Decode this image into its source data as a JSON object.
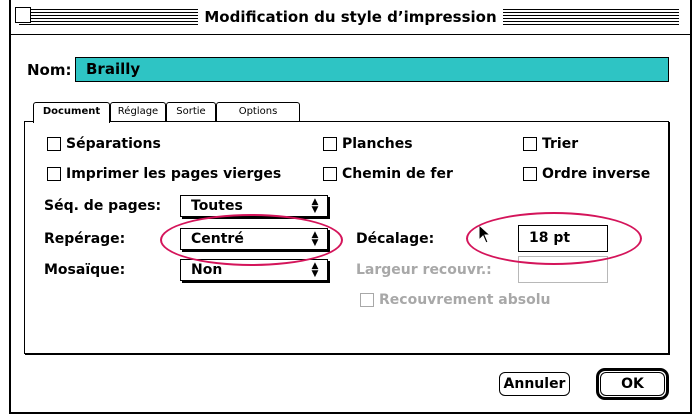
{
  "window": {
    "title": "Modification du style d’impression"
  },
  "name_row": {
    "label": "Nom:",
    "value": "Brailly"
  },
  "tabs": [
    {
      "label": "Document",
      "active": true
    },
    {
      "label": "Réglage",
      "active": false
    },
    {
      "label": "Sortie",
      "active": false
    },
    {
      "label": "Options",
      "active": false
    }
  ],
  "document_tab": {
    "checkboxes": {
      "separations": {
        "label": "Séparations",
        "checked": false,
        "enabled": true
      },
      "planches": {
        "label": "Planches",
        "checked": false,
        "enabled": true
      },
      "trier": {
        "label": "Trier",
        "checked": false,
        "enabled": true
      },
      "blank_pages": {
        "label": "Imprimer les pages vierges",
        "checked": false,
        "enabled": true
      },
      "chemin_de_fer": {
        "label": "Chemin de fer",
        "checked": false,
        "enabled": true
      },
      "ordre_inverse": {
        "label": "Ordre inverse",
        "checked": false,
        "enabled": true
      },
      "recouvrement_absolu": {
        "label": "Recouvrement absolu",
        "checked": false,
        "enabled": false
      }
    },
    "page_sequence": {
      "label": "Séq. de pages:",
      "value": "Toutes"
    },
    "registration": {
      "label": "Repérage:",
      "value": "Centré"
    },
    "tiling": {
      "label": "Mosaïque:",
      "value": "Non"
    },
    "offset": {
      "label": "Décalage:",
      "value": "18 pt"
    },
    "overlap_width": {
      "label": "Largeur recouvr.:",
      "value": "",
      "enabled": false
    }
  },
  "buttons": {
    "cancel": "Annuler",
    "ok": "OK"
  },
  "highlight_color": "#d4145a",
  "name_field_color": "#2ec4c4",
  "icons": {
    "popup_arrows": "up-down-arrows-icon",
    "cursor": "mouse-pointer-icon"
  }
}
